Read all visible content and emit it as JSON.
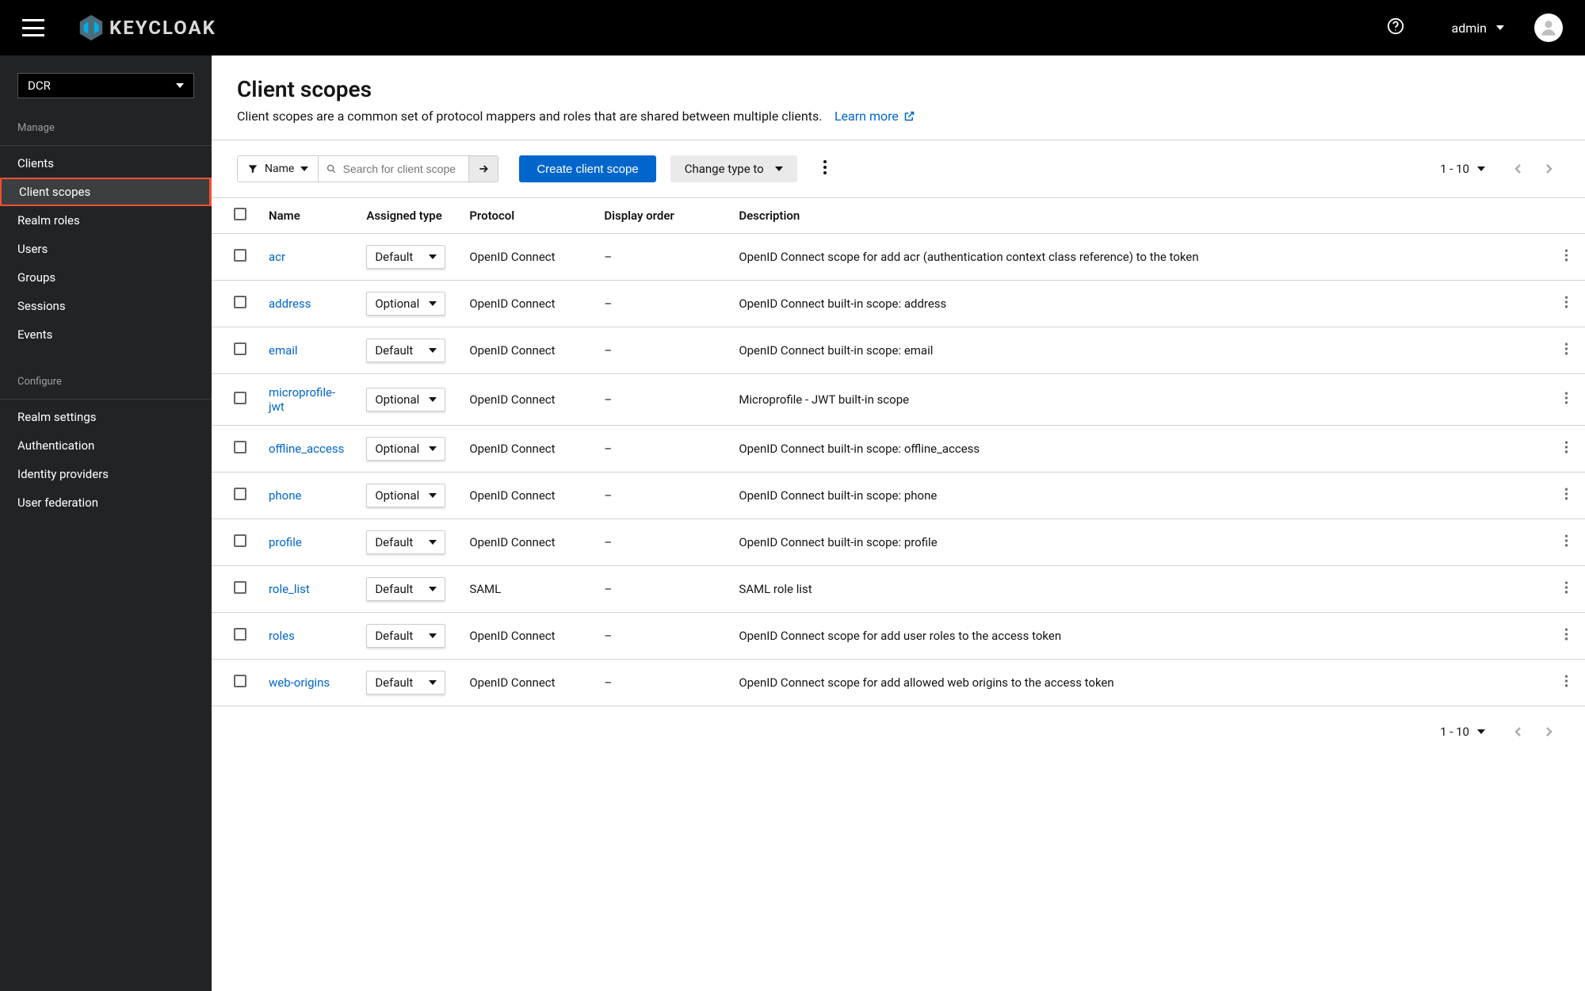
{
  "topbar": {
    "brand": "KEYCLOAK",
    "user": "admin"
  },
  "sidebar": {
    "realm": "DCR",
    "sections": [
      {
        "heading": "Manage",
        "items": [
          "Clients",
          "Client scopes",
          "Realm roles",
          "Users",
          "Groups",
          "Sessions",
          "Events"
        ],
        "activeIndex": 1
      },
      {
        "heading": "Configure",
        "items": [
          "Realm settings",
          "Authentication",
          "Identity providers",
          "User federation"
        ]
      }
    ]
  },
  "page": {
    "title": "Client scopes",
    "subtitle": "Client scopes are a common set of protocol mappers and roles that are shared between multiple clients.",
    "learnMore": "Learn more"
  },
  "toolbar": {
    "filterLabel": "Name",
    "searchPlaceholder": "Search for client scope",
    "createLabel": "Create client scope",
    "changeTypeLabel": "Change type to",
    "range": "1 - 10"
  },
  "table": {
    "headers": [
      "Name",
      "Assigned type",
      "Protocol",
      "Display order",
      "Description"
    ],
    "rows": [
      {
        "name": "acr",
        "type": "Default",
        "protocol": "OpenID Connect",
        "order": "–",
        "desc": "OpenID Connect scope for add acr (authentication context class reference) to the token"
      },
      {
        "name": "address",
        "type": "Optional",
        "protocol": "OpenID Connect",
        "order": "–",
        "desc": "OpenID Connect built-in scope: address"
      },
      {
        "name": "email",
        "type": "Default",
        "protocol": "OpenID Connect",
        "order": "–",
        "desc": "OpenID Connect built-in scope: email"
      },
      {
        "name": "microprofile-jwt",
        "type": "Optional",
        "protocol": "OpenID Connect",
        "order": "–",
        "desc": "Microprofile - JWT built-in scope"
      },
      {
        "name": "offline_access",
        "type": "Optional",
        "protocol": "OpenID Connect",
        "order": "–",
        "desc": "OpenID Connect built-in scope: offline_access"
      },
      {
        "name": "phone",
        "type": "Optional",
        "protocol": "OpenID Connect",
        "order": "–",
        "desc": "OpenID Connect built-in scope: phone"
      },
      {
        "name": "profile",
        "type": "Default",
        "protocol": "OpenID Connect",
        "order": "–",
        "desc": "OpenID Connect built-in scope: profile"
      },
      {
        "name": "role_list",
        "type": "Default",
        "protocol": "SAML",
        "order": "–",
        "desc": "SAML role list"
      },
      {
        "name": "roles",
        "type": "Default",
        "protocol": "OpenID Connect",
        "order": "–",
        "desc": "OpenID Connect scope for add user roles to the access token"
      },
      {
        "name": "web-origins",
        "type": "Default",
        "protocol": "OpenID Connect",
        "order": "–",
        "desc": "OpenID Connect scope for add allowed web origins to the access token"
      }
    ]
  },
  "footerPager": {
    "range": "1 - 10"
  }
}
